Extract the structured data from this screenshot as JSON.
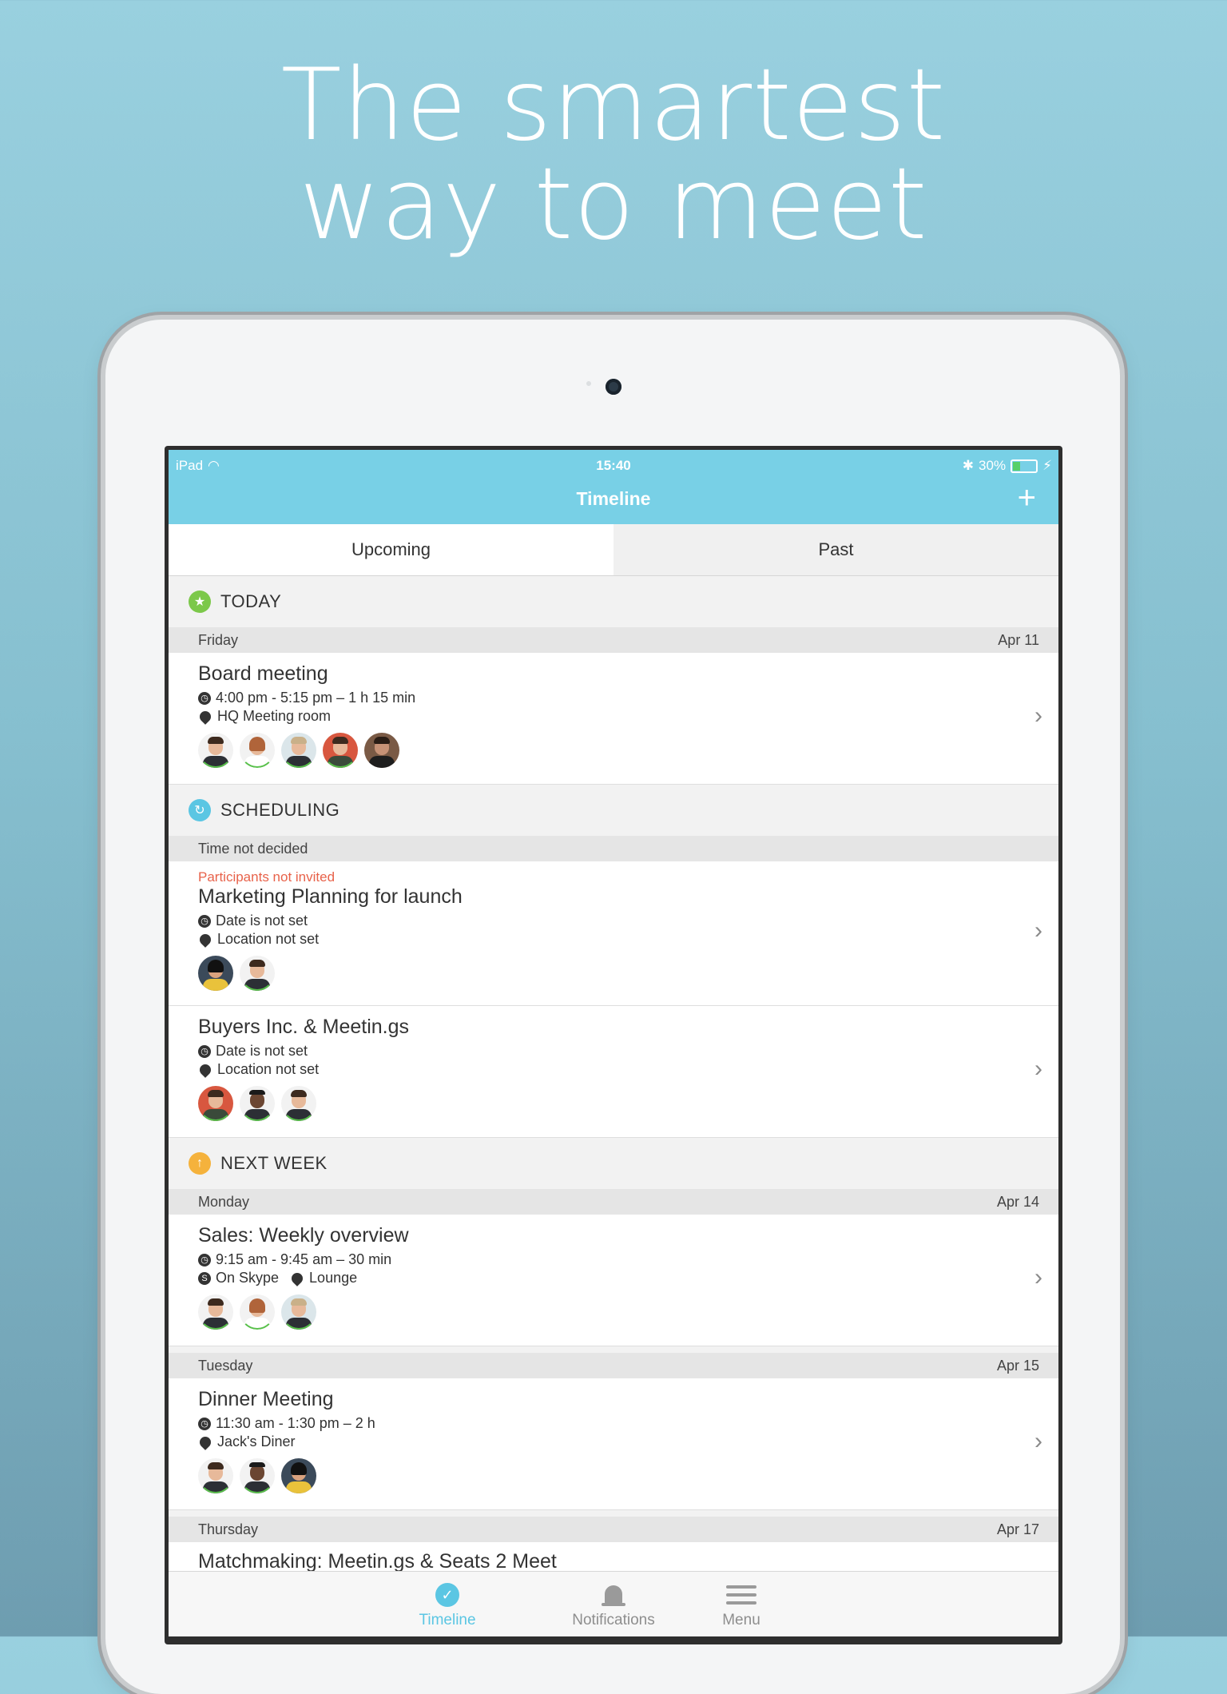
{
  "headline": {
    "line1": "The smartest",
    "line2": "way to meet"
  },
  "status": {
    "device": "iPad",
    "time": "15:40",
    "battery": "30%"
  },
  "nav": {
    "title": "Timeline",
    "add_glyph": "+"
  },
  "tabs": {
    "upcoming": "Upcoming",
    "past": "Past"
  },
  "sections": {
    "today": "TODAY",
    "scheduling": "SCHEDULING",
    "next_week": "NEXT WEEK"
  },
  "days": {
    "friday": {
      "day": "Friday",
      "date": "Apr 11"
    },
    "time_not_decided": {
      "day": "Time not decided"
    },
    "monday": {
      "day": "Monday",
      "date": "Apr 14"
    },
    "tuesday": {
      "day": "Tuesday",
      "date": "Apr 15"
    },
    "thursday": {
      "day": "Thursday",
      "date": "Apr 17"
    }
  },
  "meetings": {
    "board": {
      "title": "Board meeting",
      "time": "4:00 pm - 5:15 pm – 1 h 15 min",
      "location": "HQ Meeting room"
    },
    "marketing": {
      "warning": "Participants not invited",
      "title": "Marketing Planning for launch",
      "date": "Date is not set",
      "location": "Location not set"
    },
    "buyers": {
      "title": "Buyers Inc. & Meetin.gs",
      "date": "Date is not set",
      "location": "Location not set"
    },
    "sales": {
      "title": "Sales: Weekly overview",
      "time": "9:15 am - 9:45 am – 30 min",
      "online": "On Skype",
      "location": "Lounge"
    },
    "dinner": {
      "title": "Dinner Meeting",
      "time": "11:30 am - 1:30 pm – 2 h",
      "location": "Jack's Diner"
    },
    "matchmaking": {
      "title": "Matchmaking: Meetin.gs & Seats 2 Meet"
    }
  },
  "tabbar": {
    "timeline": "Timeline",
    "notifications": "Notifications",
    "menu": "Menu"
  },
  "colors": {
    "accent": "#78d0e6",
    "today": "#7cc84a",
    "scheduling": "#5bc6e3",
    "next_week": "#f5b23c",
    "warning": "#e8624a"
  },
  "icons": {
    "today": "star-icon",
    "scheduling": "refresh-icon",
    "next_week": "arrow-up-icon",
    "time": "clock-icon",
    "location": "pin-icon",
    "skype": "skype-icon",
    "chevron": "chevron-right-icon"
  }
}
